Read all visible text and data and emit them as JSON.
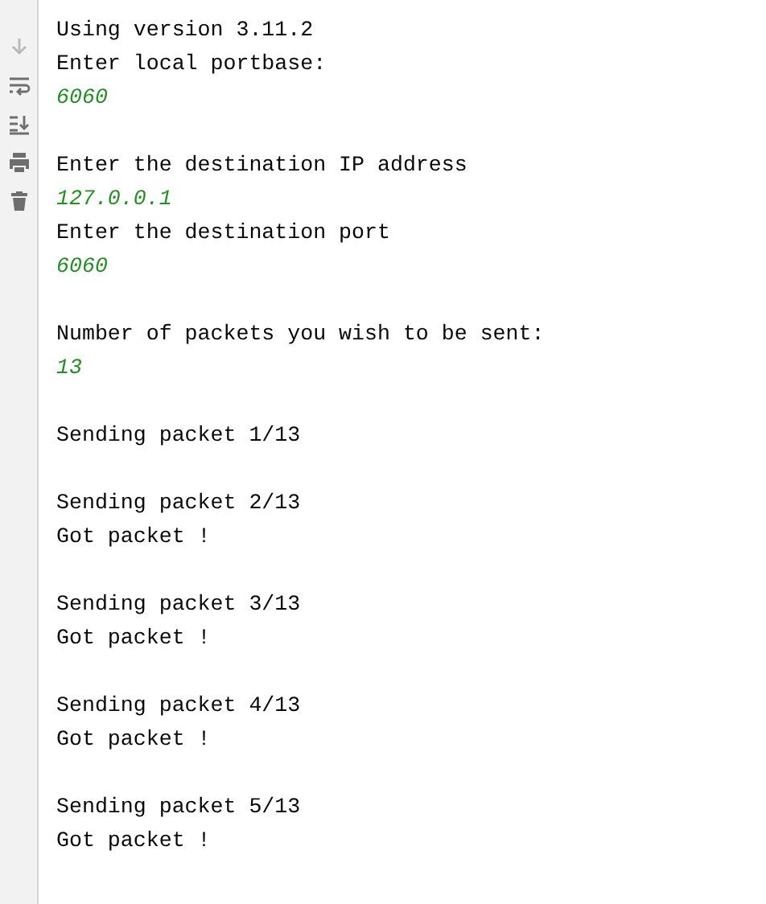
{
  "toolbar": [
    {
      "kind": "down",
      "disabled": true
    },
    {
      "kind": "wrap",
      "disabled": false
    },
    {
      "kind": "scroll-end",
      "disabled": false
    },
    {
      "kind": "print",
      "disabled": false
    },
    {
      "kind": "trash",
      "disabled": false
    }
  ],
  "console": [
    {
      "kind": "output",
      "text": "Using version 3.11.2"
    },
    {
      "kind": "output",
      "text": "Enter local portbase:"
    },
    {
      "kind": "input",
      "text": "6060"
    },
    {
      "kind": "blank"
    },
    {
      "kind": "output",
      "text": "Enter the destination IP address"
    },
    {
      "kind": "input",
      "text": "127.0.0.1"
    },
    {
      "kind": "output",
      "text": "Enter the destination port"
    },
    {
      "kind": "input",
      "text": "6060"
    },
    {
      "kind": "blank"
    },
    {
      "kind": "output",
      "text": "Number of packets you wish to be sent:"
    },
    {
      "kind": "input",
      "text": "13"
    },
    {
      "kind": "blank"
    },
    {
      "kind": "output",
      "text": "Sending packet 1/13"
    },
    {
      "kind": "blank"
    },
    {
      "kind": "output",
      "text": "Sending packet 2/13"
    },
    {
      "kind": "output",
      "text": "Got packet !"
    },
    {
      "kind": "blank"
    },
    {
      "kind": "output",
      "text": "Sending packet 3/13"
    },
    {
      "kind": "output",
      "text": "Got packet !"
    },
    {
      "kind": "blank"
    },
    {
      "kind": "output",
      "text": "Sending packet 4/13"
    },
    {
      "kind": "output",
      "text": "Got packet !"
    },
    {
      "kind": "blank"
    },
    {
      "kind": "output",
      "text": "Sending packet 5/13"
    },
    {
      "kind": "output",
      "text": "Got packet !"
    }
  ]
}
